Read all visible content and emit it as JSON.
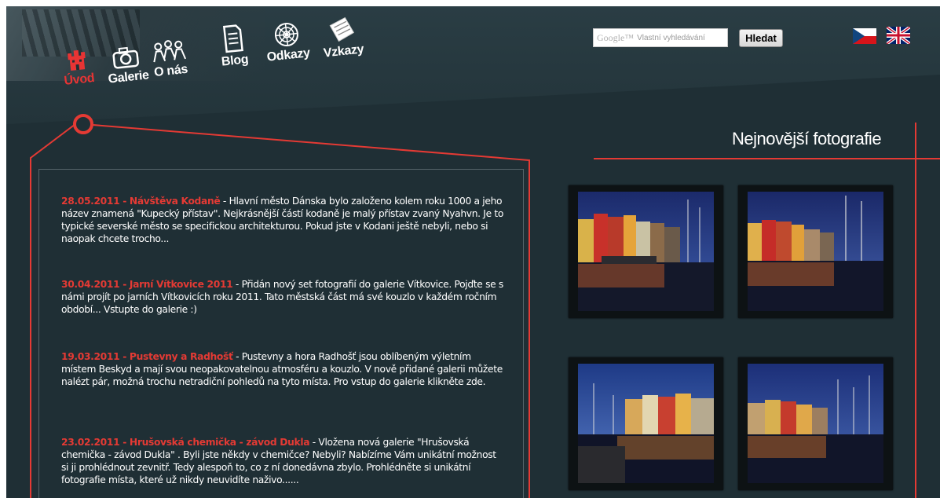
{
  "header": {
    "nav": [
      {
        "label": "Úvod",
        "icon": "castle-icon",
        "active": true
      },
      {
        "label": "Galerie",
        "icon": "camera-icon"
      },
      {
        "label": "O nás",
        "icon": "people-icon"
      },
      {
        "label": "Blog",
        "icon": "notepad-icon"
      },
      {
        "label": "Odkazy",
        "icon": "spiderweb-icon"
      },
      {
        "label": "Vzkazy",
        "icon": "paper-stack-icon"
      }
    ],
    "search": {
      "brand": "Google™",
      "placeholder": "Vlastní vyhledávání",
      "button_label": "Hledat"
    },
    "languages": [
      {
        "icon": "flag-cz-icon"
      },
      {
        "icon": "flag-uk-icon"
      }
    ]
  },
  "news": [
    {
      "head": "28.05.2011 - Návštěva Kodaně",
      "text": " - Hlavní město Dánska bylo založeno kolem roku 1000 a jeho název znamená \"Kupecký přístav\". Nejkrásnější částí kodaně je malý přístav zvaný Nyahvn. Je to typické severské město se specifickou architekturou. Pokud jste v Kodani ještě nebyli, nebo si naopak chcete trocho..."
    },
    {
      "head": "30.04.2011 - Jarní Vítkovice 2011",
      "text": " - Přidán nový set fotografií do galerie Vítkovice. Pojďte se s námi projít po jarních Vítkovicích roku 2011. Tato městská část má své kouzlo v každém ročním období... Vstupte do galerie :)"
    },
    {
      "head": "19.03.2011 - Pustevny a Radhošť",
      "text": " - Pustevny a hora Radhošť jsou oblíbeným výletním místem Beskyd a mají svou neopakovatelnou atmosféru a kouzlo. V nově přidané galerii můžete nalézt pár, možná trochu netradiční pohledů na tyto místa. Pro vstup do galerie klikněte zde."
    },
    {
      "head": "23.02.2011 - Hrušovská chemička - závod Dukla",
      "text": " - Vložena nová galerie \"Hrušovská chemička - závod Dukla\" . Byli jste někdy v chemičce? Nebyli? Nabízíme Vám unikátní možnost si ji prohlédnout zevnitř. Tedy alespoň to, co z ní donedávna zbylo. Prohlédněte si unikátní fotografie místa, které už nikdy neuvidíte naživo......"
    }
  ],
  "photos": {
    "title": "Nejnovější fotografie",
    "items": [
      {
        "name": "nyhavn-photo-1"
      },
      {
        "name": "nyhavn-photo-2"
      },
      {
        "name": "nyhavn-photo-3"
      },
      {
        "name": "nyhavn-photo-4"
      }
    ]
  },
  "colors": {
    "background": "#1f2f35",
    "accent_red": "#e43a34",
    "text": "#ffffff"
  }
}
